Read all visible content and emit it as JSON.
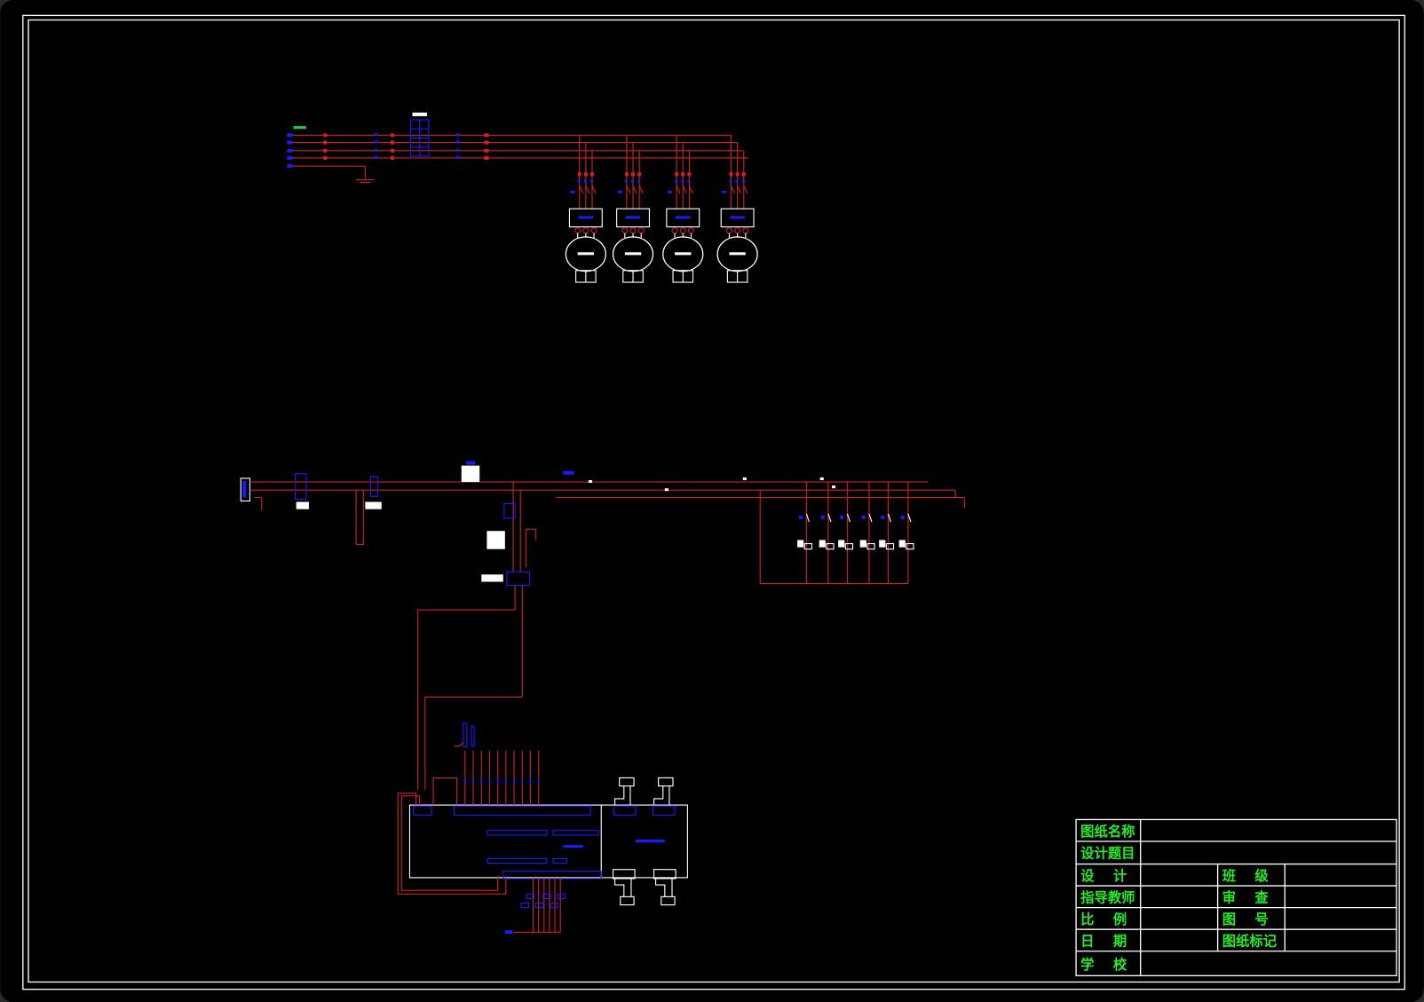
{
  "colors": {
    "background": "#000000",
    "frame": "#ffffff",
    "wire": "#d42020",
    "component": "#1a1aff",
    "title_text": "#22ee22"
  },
  "title_block": {
    "drawing_name_label": "图纸名称",
    "design_topic_label": "设计题目",
    "designer_label": "设    计",
    "class_label": "班    级",
    "instructor_label": "指导教师",
    "review_label": "审    查",
    "scale_label": "比    例",
    "drawing_number_label": "图    号",
    "date_label": "日    期",
    "drawing_mark_label": "图纸标记",
    "school_label": "学    校"
  },
  "diagram": {
    "motor_count": 4,
    "relay_branch_count": 6,
    "plc_input_wire_count": 10,
    "plc_output_wire_count": 6
  }
}
